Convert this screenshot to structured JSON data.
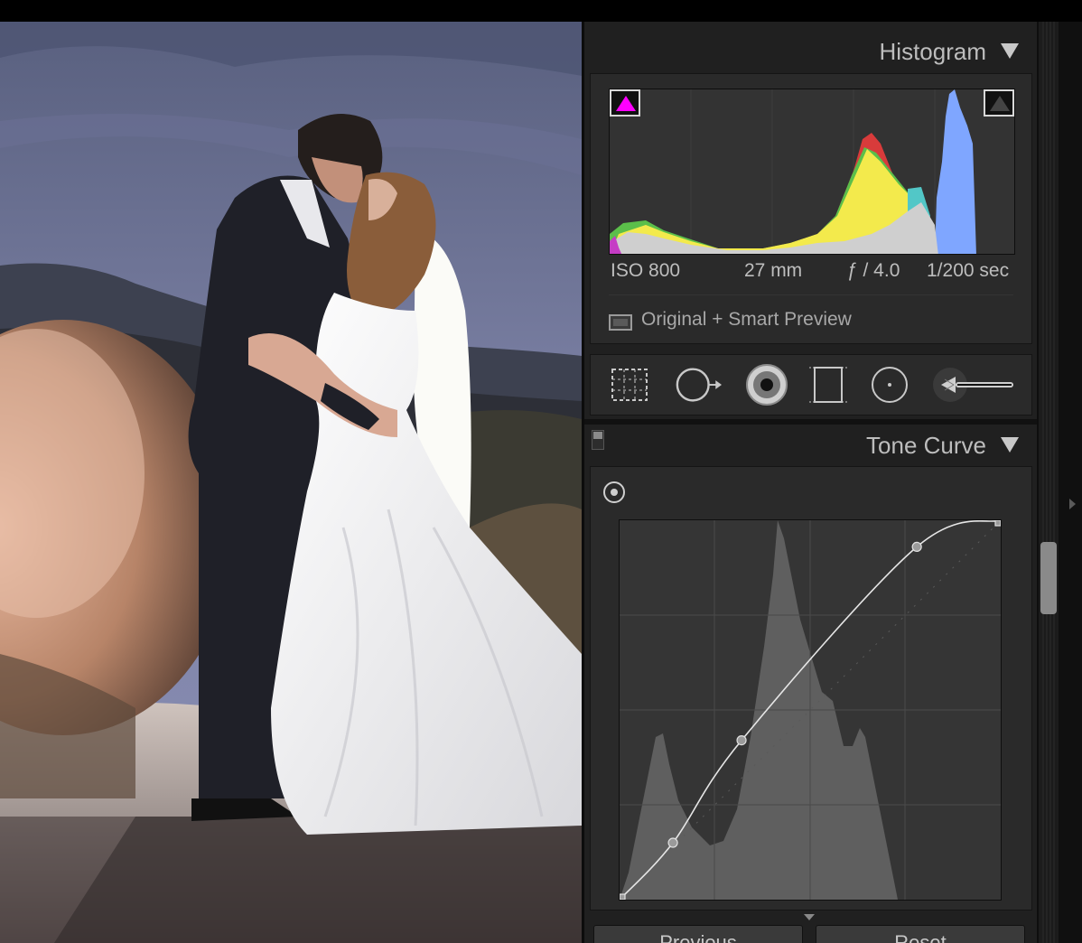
{
  "histogram": {
    "title": "Histogram",
    "exif": {
      "iso": "ISO 800",
      "focal_length": "27 mm",
      "aperture": "ƒ / 4.0",
      "shutter": "1/200 sec"
    },
    "preview_status": "Original + Smart Preview",
    "shadow_clip_color": "#ff00ff",
    "highlight_clip_color": "#444444"
  },
  "tools": [
    {
      "name": "crop-overlay-tool",
      "icon": "crop-icon"
    },
    {
      "name": "spot-removal-tool",
      "icon": "spot-removal-icon"
    },
    {
      "name": "red-eye-tool",
      "icon": "red-eye-icon"
    },
    {
      "name": "graduated-filter-tool",
      "icon": "graduated-filter-icon"
    },
    {
      "name": "radial-filter-tool",
      "icon": "radial-filter-icon"
    },
    {
      "name": "adjustment-brush-tool",
      "icon": "brush-icon"
    }
  ],
  "tone_curve": {
    "title": "Tone Curve",
    "control_points": [
      [
        0,
        0
      ],
      [
        0.14,
        0.15
      ],
      [
        0.32,
        0.42
      ],
      [
        0.78,
        0.93
      ],
      [
        1,
        1
      ]
    ]
  },
  "buttons": {
    "previous": "Previous",
    "reset": "Reset"
  }
}
